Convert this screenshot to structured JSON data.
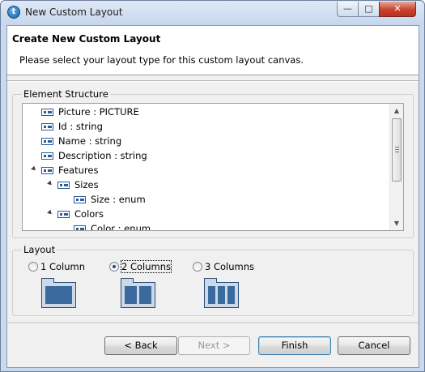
{
  "window": {
    "title": "New Custom Layout",
    "app_icon_glyph": "t"
  },
  "header": {
    "title": "Create New Custom Layout",
    "description": "Please select your layout type for this custom layout canvas."
  },
  "element_structure": {
    "label": "Element Structure",
    "items": [
      {
        "label": "Picture : PICTURE"
      },
      {
        "label": "Id : string"
      },
      {
        "label": "Name : string"
      },
      {
        "label": "Description : string"
      },
      {
        "label": "Features"
      },
      {
        "label": "Sizes"
      },
      {
        "label": "Size : enum"
      },
      {
        "label": "Colors"
      },
      {
        "label": "Color : enum"
      }
    ]
  },
  "layout": {
    "label": "Layout",
    "options": [
      {
        "label": "1 Column",
        "selected": false
      },
      {
        "label": "2 Columns",
        "selected": true
      },
      {
        "label": "3 Columns",
        "selected": false
      }
    ]
  },
  "buttons": {
    "back": "< Back",
    "next": "Next >",
    "finish": "Finish",
    "cancel": "Cancel"
  },
  "colors": {
    "accent": "#3a6a9e",
    "titlebar": "#c9d9ee",
    "close": "#c8432f"
  }
}
